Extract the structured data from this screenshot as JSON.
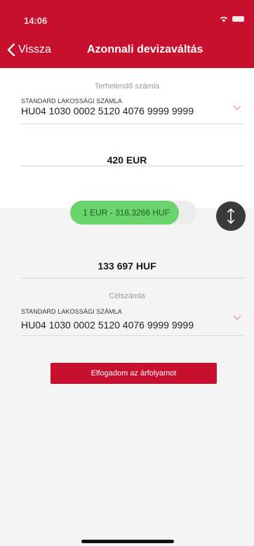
{
  "status_bar": {
    "time": "14:06"
  },
  "nav": {
    "back_label": "Vissza",
    "title": "Azonnali devizaváltás"
  },
  "source_account": {
    "caption": "Terhelendő számla",
    "type": "STANDARD LAKOSSÁGI SZÁMLA",
    "number": "HU04 1030 0002 5120 4076 9999 9999"
  },
  "source_amount": "420 EUR",
  "exchange_rate": {
    "label": "1 EUR - 318,3266 HUF",
    "fill_fraction": 0.97
  },
  "target_amount": "133 697 HUF",
  "target_account": {
    "caption": "Célszámla",
    "type": "STANDARD LAKOSSÁGI SZÁMLA",
    "number": "HU04 1030 0002 5120 4076 9999 9999"
  },
  "accept_button": "Elfogadom az árfolyamot",
  "icons": {
    "back": "chevron-left-icon",
    "swap": "swap-vertical-icon",
    "dropdown": "chevron-down-icon"
  },
  "colors": {
    "brand": "#c8102e",
    "rate_fill": "#6bd36b",
    "swap_bg": "#3a3a3a"
  }
}
